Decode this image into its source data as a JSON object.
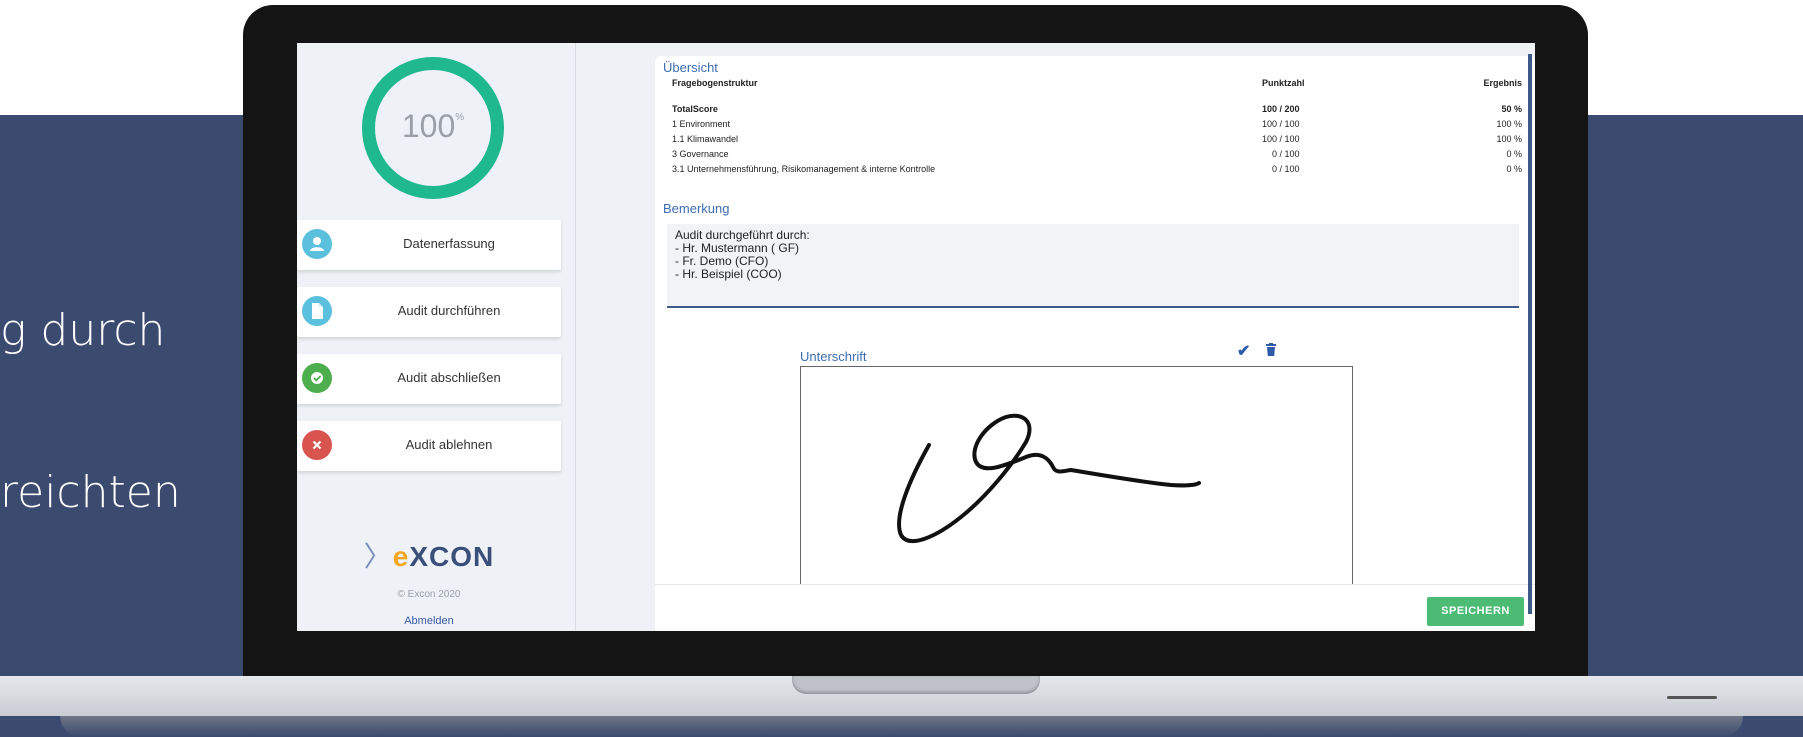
{
  "promo": {
    "line1_fragment": "g durch",
    "line2_fragment": "reichten"
  },
  "sidebar": {
    "progress": {
      "value_text": "100",
      "unit": "%",
      "value": 100
    },
    "items": [
      {
        "label": "Datenerfassung",
        "icon": "user-icon",
        "color": "#5bc0de"
      },
      {
        "label": "Audit durchführen",
        "icon": "document-icon",
        "color": "#5bc0de"
      },
      {
        "label": "Audit abschließen",
        "icon": "check-circle-icon",
        "color": "#4cae4c"
      },
      {
        "label": "Audit ablehnen",
        "icon": "close-icon",
        "color": "#d9534f"
      }
    ],
    "logo": {
      "chevron": "〉",
      "e": "e",
      "rest": "XCON"
    },
    "copyright": "© Excon 2020",
    "logout": "Abmelden"
  },
  "overview": {
    "title": "Übersicht",
    "headers": [
      "Fragebogenstruktur",
      "Punktzahl",
      "Ergebnis"
    ],
    "rows": [
      {
        "name": "TotalScore",
        "score": "100 / 200",
        "result": "50 %"
      },
      {
        "name": "1 Environment",
        "score": "100 / 100",
        "result": "100 %"
      },
      {
        "name": "1.1 Klimawandel",
        "score": "100 / 100",
        "result": "100 %"
      },
      {
        "name": "3 Governance",
        "score": "0 / 100",
        "result": "0 %"
      },
      {
        "name": "3.1 Unternehmensführung, Risikomanagement & interne Kontrolle",
        "score": "0 / 100",
        "result": "0 %"
      }
    ]
  },
  "remark": {
    "title": "Bemerkung",
    "lines": [
      "Audit durchgeführt durch:",
      "- Hr. Mustermann ( GF)",
      "- Fr. Demo (CFO)",
      "- Hr. Beispiel (COO)"
    ]
  },
  "signature": {
    "label": "Unterschrift",
    "confirm_icon": "checkmark-icon",
    "delete_icon": "trash-icon"
  },
  "footer": {
    "save_label": "SPEICHERN"
  },
  "colors": {
    "accent": "#3b6db2",
    "progress": "#1fb98d",
    "save": "#4cbb73",
    "background": "#3b4a6f"
  }
}
